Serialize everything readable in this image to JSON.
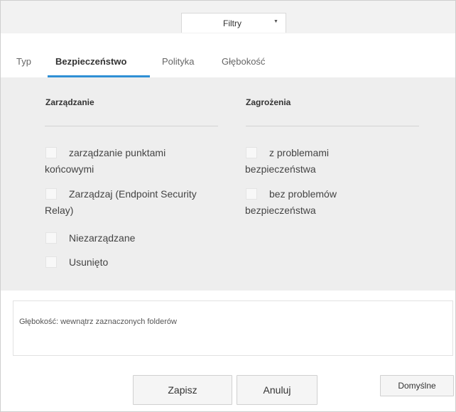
{
  "header": {
    "filter_select": {
      "label": "Filtry",
      "caret": "▼"
    }
  },
  "tabs": [
    {
      "label": "Typ",
      "active": false
    },
    {
      "label": "Bezpieczeństwo",
      "active": true
    },
    {
      "label": "Polityka",
      "active": false
    },
    {
      "label": "Głębokość",
      "active": false
    }
  ],
  "panel": {
    "management": {
      "title": "Zarządzanie",
      "options": [
        {
          "label": "zarządzanie punktami końcowymi",
          "checked": false
        },
        {
          "label": "Zarządzaj (Endpoint Security Relay)",
          "checked": false
        },
        {
          "label": "Niezarządzane",
          "checked": false
        },
        {
          "label": "Usunięto",
          "checked": false
        }
      ]
    },
    "threats": {
      "title": "Zagrożenia",
      "options": [
        {
          "label": "z problemami bezpieczeństwa",
          "checked": false
        },
        {
          "label": "bez problemów bezpieczeństwa",
          "checked": false
        }
      ]
    }
  },
  "depth_summary": "Głębokość: wewnątrz zaznaczonych folderów",
  "buttons": {
    "save": "Zapisz",
    "cancel": "Anuluj",
    "defaults": "Domyślne"
  },
  "colors": {
    "active_tab_underline": "#2f8fd5",
    "panel_bg": "#eeeeee"
  }
}
